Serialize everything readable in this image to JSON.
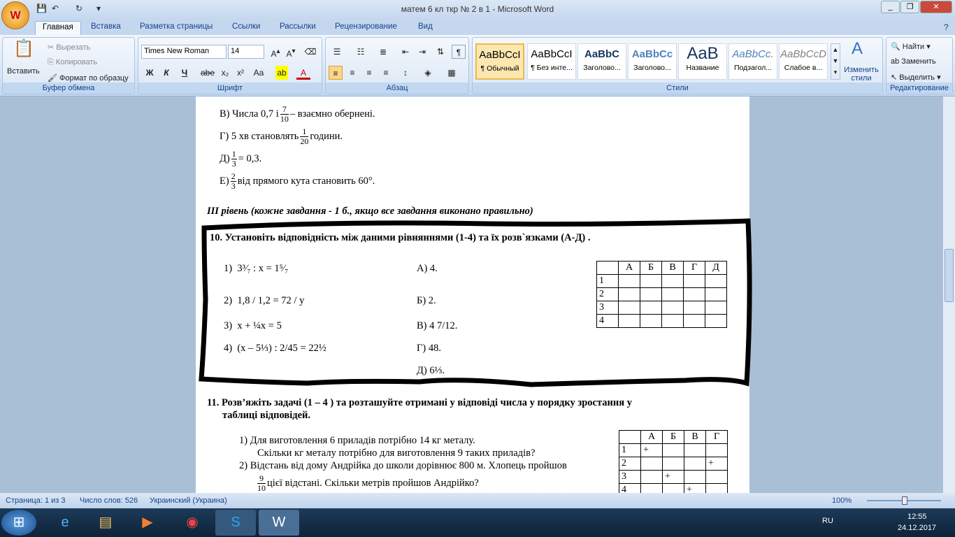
{
  "window": {
    "title": "матем 6 кл ткр № 2 в 1  -  Microsoft Word",
    "office_button": "W",
    "qa_icons": [
      "save-icon",
      "undo-icon",
      "redo-icon",
      "customize-icon"
    ],
    "controls": [
      "_",
      "❐",
      "✕"
    ]
  },
  "tabs": [
    "Главная",
    "Вставка",
    "Разметка страницы",
    "Ссылки",
    "Рассылки",
    "Рецензирование",
    "Вид"
  ],
  "ribbon": {
    "clipboard": {
      "label": "Буфер обмена",
      "paste": "Вставить",
      "cut": "Вырезать",
      "copy": "Копировать",
      "format": "Формат по образцу"
    },
    "font": {
      "label": "Шрифт",
      "family": "Times New Roman",
      "size": "14",
      "buttons": [
        "Ж",
        "К",
        "Ч",
        "abe",
        "x₂",
        "x²",
        "Aa"
      ]
    },
    "paragraph": {
      "label": "Абзац"
    },
    "styles": {
      "label": "Стили",
      "items": [
        {
          "sample": "AaBbCcI",
          "name": "¶ Обычный"
        },
        {
          "sample": "AaBbCcI",
          "name": "¶ Без инте..."
        },
        {
          "sample": "AaBbC",
          "name": "Заголово..."
        },
        {
          "sample": "AaBbCc",
          "name": "Заголово..."
        },
        {
          "sample": "AaB",
          "name": "Название"
        },
        {
          "sample": "AaBbCc.",
          "name": "Подзагол..."
        },
        {
          "sample": "AaBbCcD",
          "name": "Слабое в..."
        }
      ],
      "change": "Изменить стили"
    },
    "editing": {
      "label": "Редактирование",
      "find": "Найти",
      "replace": "Заменить",
      "select": "Выделить"
    }
  },
  "doc": {
    "v": {
      "pre": "В) Числа 0,7 і",
      "n": "7",
      "d": "10",
      "post": "– взаємно обернені."
    },
    "g": {
      "pre": "Г)  5 хв становлять",
      "n": "1",
      "d": "20",
      "post": "години."
    },
    "d": {
      "pre": "Д)",
      "n": "1",
      "d": "3",
      "post": "= 0,3."
    },
    "e": {
      "pre": "Е)",
      "n": "2",
      "d": "3",
      "post": "від прямого кута становить 60°."
    },
    "level": "ІІІ рівень (кожне завдання - 1 б., якщо все завдання виконано правильно)",
    "q10": "10. Установіть відповідність між даними рівняннями  (1-4) та  їх розв`язками  (А-Д) .",
    "eq": [
      {
        "num": "1)",
        "text": "3³⁄₇ : x = 1⁵⁄₇"
      },
      {
        "num": "2)",
        "text": "1,8 / 1,2 = 72 / y"
      },
      {
        "num": "3)",
        "text": "x + ¼x = 5"
      },
      {
        "num": "4)",
        "text": "(x – 5⅓) : 2/45 = 22½"
      }
    ],
    "answers": [
      "А)  4.",
      "Б)  2.",
      "В)  4 7/12.",
      "Г)  48.",
      "Д)  6⅓."
    ],
    "table10": {
      "header": [
        "",
        "А",
        "Б",
        "В",
        "Г",
        "Д"
      ],
      "rows": [
        "1",
        "2",
        "3",
        "4"
      ]
    },
    "q11a": "11. Розв’яжіть задачі (1 – 4 )  та розташуйте отримані у відповіді числа у порядку зростання у",
    "q11b": "таблиці відповідей.",
    "p1a": "1)   Для виготовлення 6 приладів потрібно 14 кг металу.",
    "p1b": "Скільки кг металу потрібно для виготовлення 9 таких приладів?",
    "p2a": "2)   Відстань від дому Андрійка до школи дорівнює 800 м. Хлопець пройшов",
    "p2b": "цієї відстані. Скільки метрів пройшов Андрійко?",
    "p2n": "9",
    "p2d": "10",
    "table11": {
      "header": [
        "",
        "А",
        "Б",
        "В",
        "Г"
      ],
      "rows": [
        [
          "1",
          "+",
          "",
          "",
          ""
        ],
        [
          "2",
          "",
          "",
          "",
          "+"
        ],
        [
          "3",
          "",
          "+",
          "",
          ""
        ],
        [
          "4",
          "",
          "",
          "+",
          ""
        ]
      ]
    }
  },
  "status": {
    "page": "Страница: 1 из 3",
    "words": "Число слов: 526",
    "lang": "Украинский (Украина)",
    "zoom": "100%",
    "zoom_level": 100
  },
  "taskbar": {
    "lang": "RU",
    "time": "12:55",
    "date": "24.12.2017",
    "apps": [
      "internet-explorer-icon",
      "file-explorer-icon",
      "media-player-icon",
      "chrome-icon",
      "skype-icon",
      "word-icon"
    ]
  }
}
